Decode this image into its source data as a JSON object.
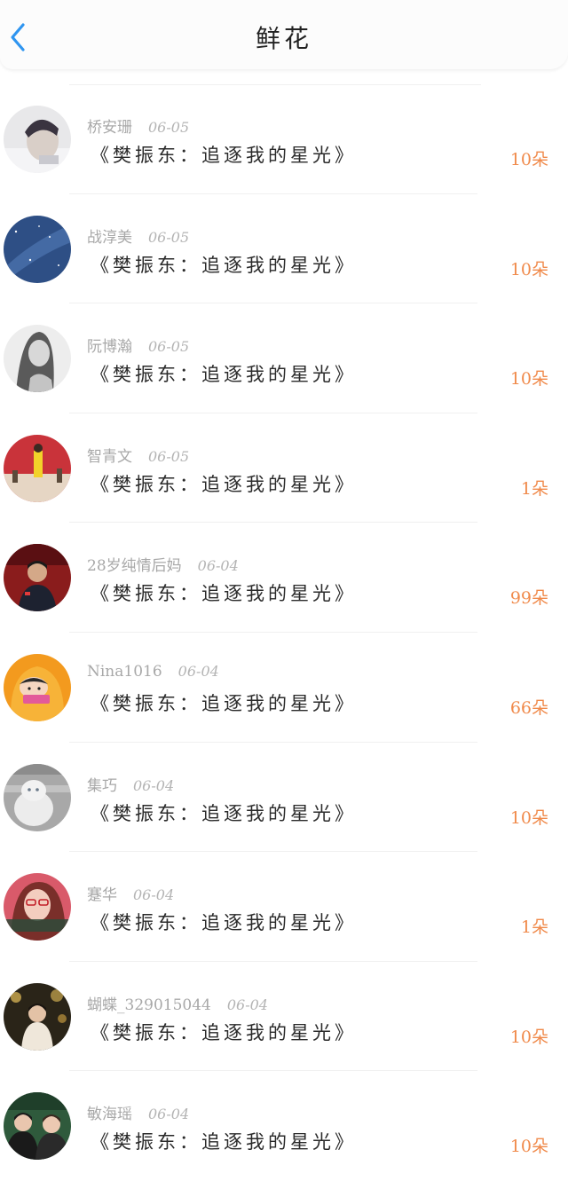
{
  "header": {
    "title": "鲜花",
    "back_icon": "chevron-left-icon",
    "accent_color": "#2f95f0"
  },
  "colors": {
    "amount": "#f08a4b",
    "meta": "#a8a8a8"
  },
  "records": [
    {
      "user": "桥安珊",
      "date": "06-05",
      "book": "《樊振东：追逐我的星光》",
      "amount": "10朵",
      "avatar": "avatar-photo-boy"
    },
    {
      "user": "战淳美",
      "date": "06-05",
      "book": "《樊振东：追逐我的星光》",
      "amount": "10朵",
      "avatar": "avatar-starry-sky"
    },
    {
      "user": "阮博瀚",
      "date": "06-05",
      "book": "《樊振东：追逐我的星光》",
      "amount": "10朵",
      "avatar": "avatar-ink-portrait"
    },
    {
      "user": "智青文",
      "date": "06-05",
      "book": "《樊振东：追逐我的星光》",
      "amount": "1朵",
      "avatar": "avatar-red-stage"
    },
    {
      "user": "28岁纯情后妈",
      "date": "06-04",
      "book": "《樊振东：追逐我的星光》",
      "amount": "99朵",
      "avatar": "avatar-athlete"
    },
    {
      "user": "Nina1016",
      "date": "06-04",
      "book": "《樊振东：追逐我的星光》",
      "amount": "66朵",
      "avatar": "avatar-cartoon"
    },
    {
      "user": "集巧",
      "date": "06-04",
      "book": "《樊振东：追逐我的星光》",
      "amount": "10朵",
      "avatar": "avatar-cat"
    },
    {
      "user": "蹇华",
      "date": "06-04",
      "book": "《樊振东：追逐我的星光》",
      "amount": "1朵",
      "avatar": "avatar-girl-glasses"
    },
    {
      "user": "蝴蝶_329015044",
      "date": "06-04",
      "book": "《樊振东：追逐我的星光》",
      "amount": "10朵",
      "avatar": "avatar-night-lights"
    },
    {
      "user": "敏海瑶",
      "date": "06-04",
      "book": "《樊振东：追逐我的星光》",
      "amount": "10朵",
      "avatar": "avatar-two-girls"
    }
  ]
}
